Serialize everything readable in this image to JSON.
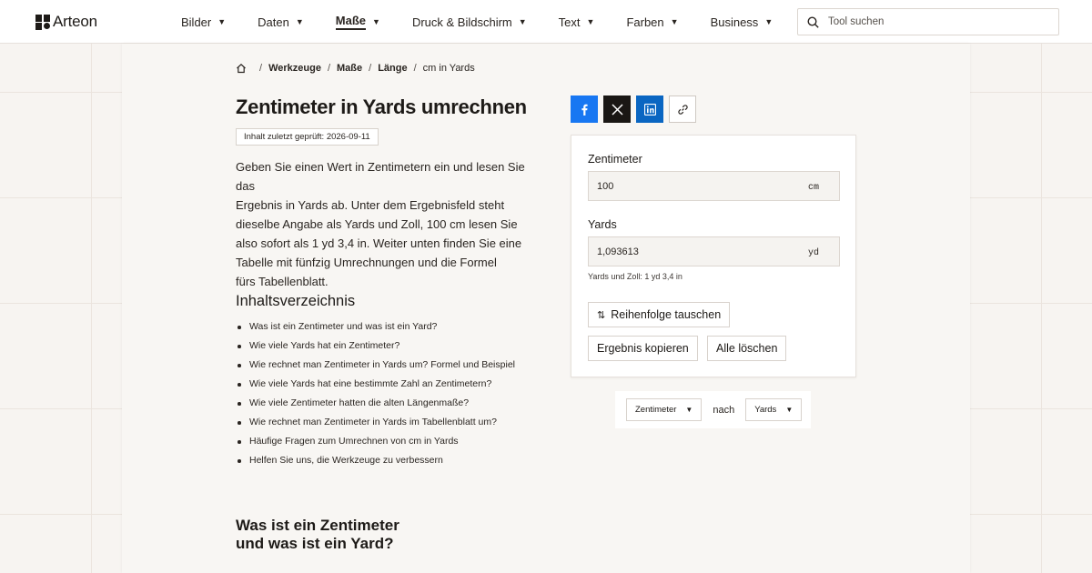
{
  "brand": {
    "name": "Arteon"
  },
  "nav": [
    {
      "label": "Bilder",
      "active": false
    },
    {
      "label": "Daten",
      "active": false
    },
    {
      "label": "Maße",
      "active": true
    },
    {
      "label": "Druck & Bildschirm",
      "active": false
    },
    {
      "label": "Text",
      "active": false
    },
    {
      "label": "Farben",
      "active": false
    },
    {
      "label": "Business",
      "active": false
    }
  ],
  "search": {
    "placeholder": "Tool suchen",
    "icon": "search-icon"
  },
  "breadcrumb": {
    "items": [
      "Werkzeuge",
      "Maße",
      "Länge"
    ],
    "current": "cm in Yards",
    "separator": "/"
  },
  "page": {
    "title": "Zentimeter in Yards umrechnen",
    "checked_badge": "Inhalt zuletzt geprüft: 2026-09-11",
    "intro_lines": [
      "Geben Sie einen Wert in Zentimetern ein und lesen Sie das",
      "Ergebnis in Yards ab. Unter dem Ergebnisfeld steht",
      "dieselbe Angabe als Yards und Zoll, 100 cm lesen Sie",
      "also sofort als 1 yd 3,4 in. Weiter unten finden Sie eine",
      "Tabelle mit fünfzig Umrechnungen und die Formel",
      "fürs Tabellenblatt."
    ]
  },
  "toc": {
    "heading": "Inhaltsverzeichnis",
    "items": [
      "Was ist ein Zentimeter und was ist ein Yard?",
      "Wie viele Yards hat ein Zentimeter?",
      "Wie rechnet man Zentimeter in Yards um? Formel und Beispiel",
      "Wie viele Yards hat eine bestimmte Zahl an Zentimetern?",
      "Wie viele Zentimeter hatten die alten Längenmaße?",
      "Wie rechnet man Zentimeter in Yards im Tabellenblatt um?",
      "Häufige Fragen zum Umrechnen von cm in Yards",
      "Helfen Sie uns, die Werkzeuge zu verbessern"
    ]
  },
  "section": {
    "heading_line1": "Was ist ein Zentimeter",
    "heading_line2": "und was ist ein Yard?"
  },
  "share": {
    "buttons": [
      "facebook-icon",
      "x-icon",
      "linkedin-icon",
      "link-icon"
    ],
    "colors": {
      "facebook": "#1877f2",
      "x": "#1a1714",
      "linkedin": "#0a66c2"
    }
  },
  "converter": {
    "from_label": "Zentimeter",
    "from_value": "100",
    "from_unit": "cm",
    "to_label": "Yards",
    "to_value": "1,093613",
    "to_unit": "yd",
    "note": "Yards und Zoll: 1 yd 3,4 in",
    "swap_label": "Reihenfolge tauschen",
    "copy_label": "Ergebnis kopieren",
    "clear_label": "Alle löschen"
  },
  "unit_selector": {
    "from_selected": "Zentimeter",
    "connector": "nach",
    "to_selected": "Yards"
  }
}
